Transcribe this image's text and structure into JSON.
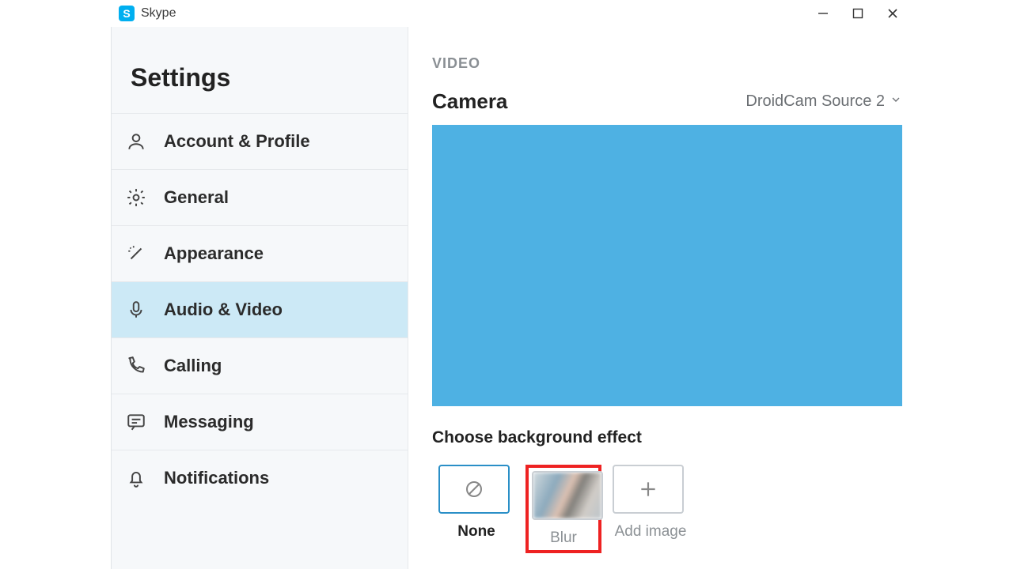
{
  "app": {
    "name": "Skype",
    "logo_letter": "S"
  },
  "sidebar": {
    "title": "Settings",
    "items": [
      {
        "label": "Account & Profile"
      },
      {
        "label": "General"
      },
      {
        "label": "Appearance"
      },
      {
        "label": "Audio & Video"
      },
      {
        "label": "Calling"
      },
      {
        "label": "Messaging"
      },
      {
        "label": "Notifications"
      }
    ]
  },
  "main": {
    "section": "VIDEO",
    "camera_label": "Camera",
    "camera_source": "DroidCam Source 2",
    "bg_effect_label": "Choose background effect",
    "effects": {
      "none": "None",
      "blur": "Blur",
      "add": "Add image"
    }
  },
  "colors": {
    "preview_fill": "#4eb1e3",
    "highlight_border": "#e22222",
    "sidebar_active": "#cce9f6"
  }
}
